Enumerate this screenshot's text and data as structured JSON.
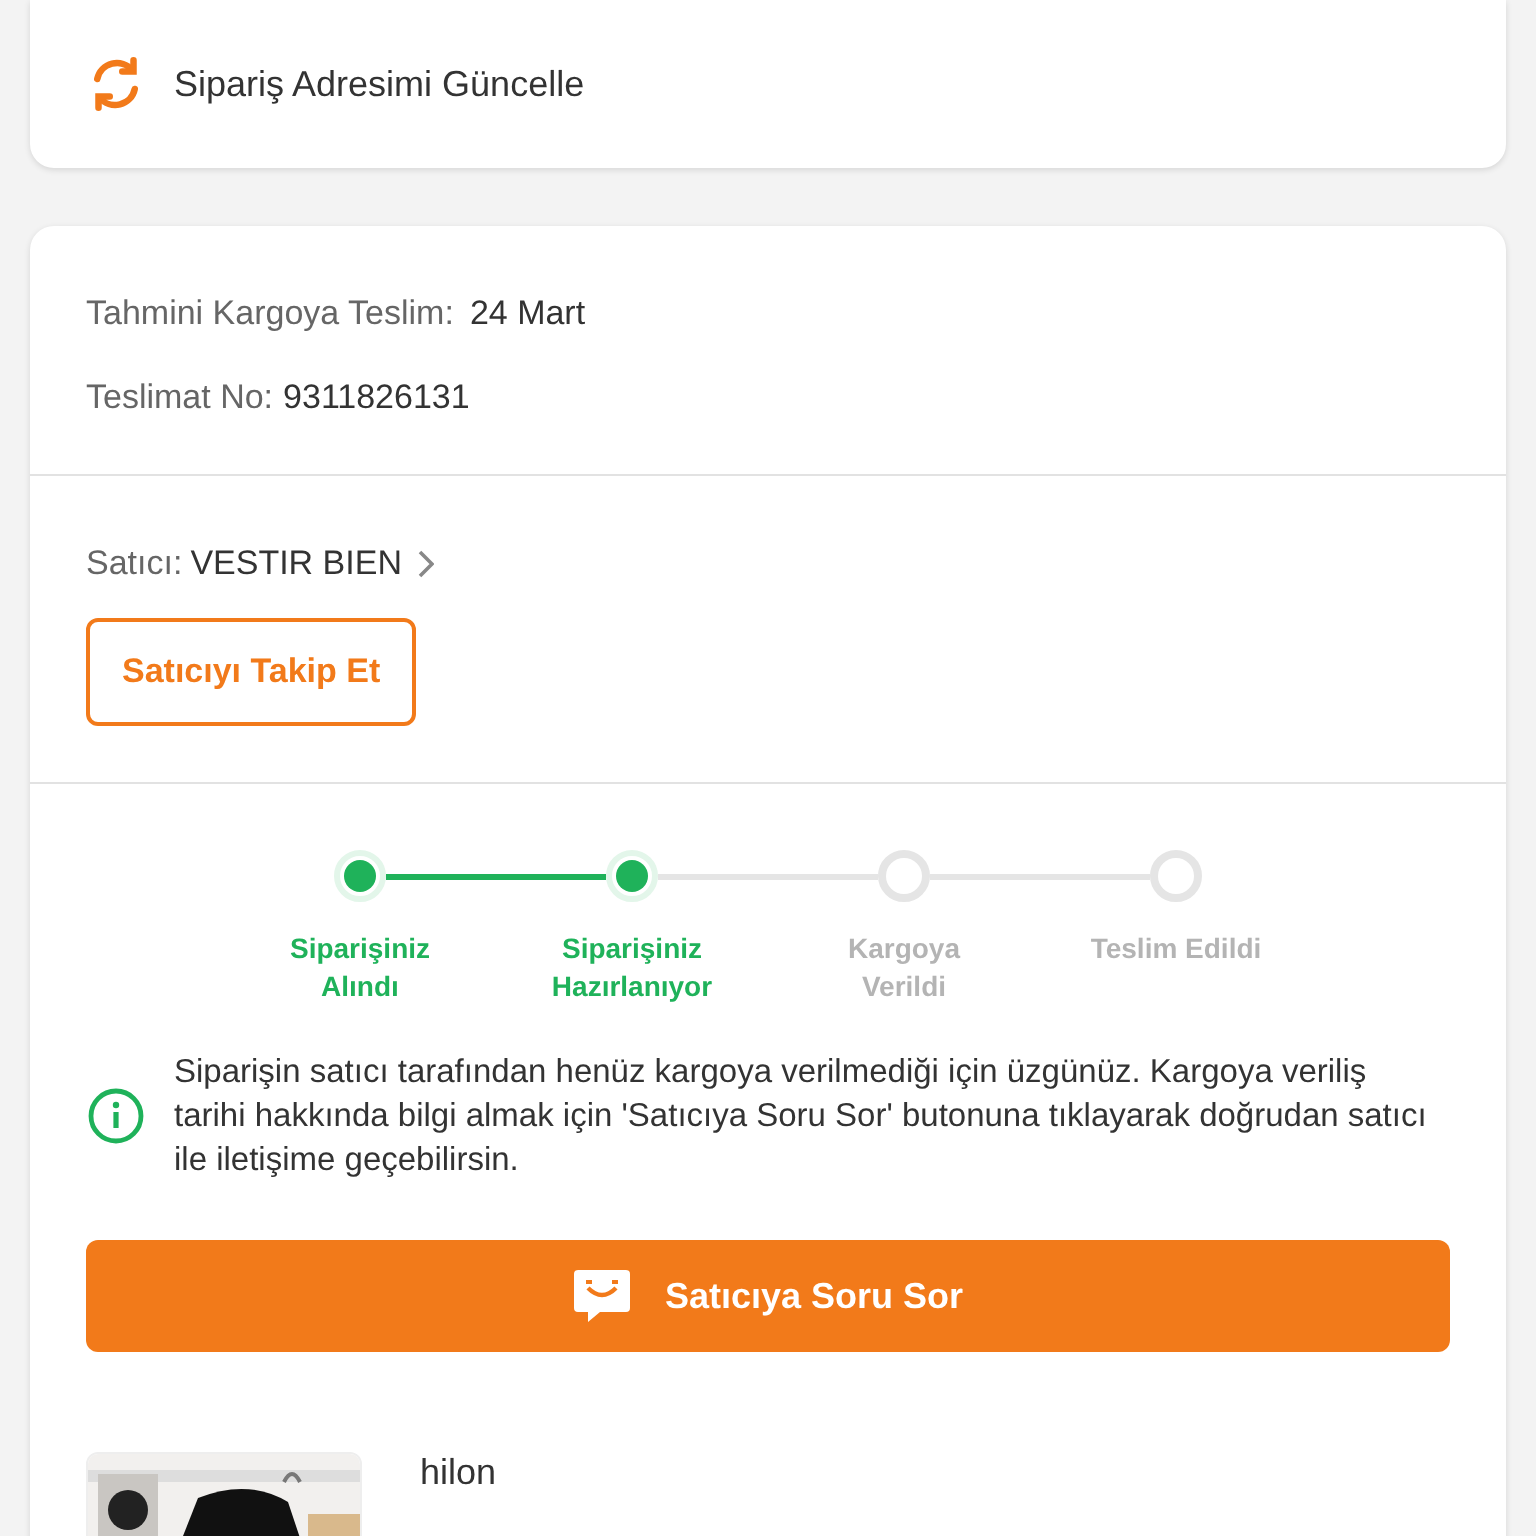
{
  "address_update": {
    "label": "Sipariş Adresimi Güncelle"
  },
  "delivery": {
    "estimate_label": "Tahmini Kargoya Teslim:",
    "estimate_value": "24 Mart",
    "number_label": "Teslimat No:",
    "number_value": "9311826131"
  },
  "seller": {
    "label": "Satıcı:",
    "name": "VESTIR BIEN",
    "follow_button": "Satıcıyı Takip Et"
  },
  "steps": [
    {
      "label": "Siparişiniz Alındı",
      "done": true
    },
    {
      "label": "Siparişiniz Hazırlanıyor",
      "done": true
    },
    {
      "label": "Kargoya Verildi",
      "done": false
    },
    {
      "label": "Teslim Edildi",
      "done": false
    }
  ],
  "notice": "Siparişin satıcı tarafından henüz kargoya verilmediği için üzgünüz. Kargoya veriliş tarihi hakkında bilgi almak için 'Satıcıya Soru Sor' butonuna tıklayarak doğrudan satıcı ile iletişime geçebilirsin.",
  "ask_button": "Satıcıya Soru Sor",
  "product": {
    "name": "hilon"
  }
}
